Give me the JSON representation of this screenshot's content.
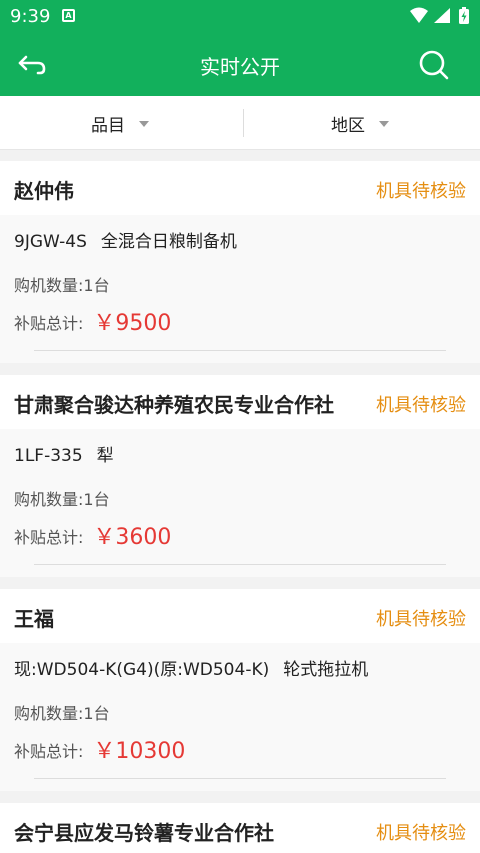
{
  "status_bar": {
    "time": "9:39",
    "app_icon_letter": "A"
  },
  "header": {
    "title": "实时公开"
  },
  "filters": [
    {
      "label": "品目"
    },
    {
      "label": "地区"
    }
  ],
  "labels": {
    "quantity": "购机数量:",
    "subsidy": "补贴总计:"
  },
  "records": [
    {
      "name": "赵仲伟",
      "status": "机具待核验",
      "model": "9JGW-4S",
      "product": "全混合日粮制备机",
      "quantity": "1台",
      "subsidy": "￥9500"
    },
    {
      "name": "甘肃聚合骏达种养殖农民专业合作社",
      "status": "机具待核验",
      "model": "1LF-335",
      "product": "犁",
      "quantity": "1台",
      "subsidy": "￥3600"
    },
    {
      "name": "王福",
      "status": "机具待核验",
      "model": "现:WD504-K(G4)(原:WD504-K)",
      "product": "轮式拖拉机",
      "quantity": "1台",
      "subsidy": "￥10300"
    },
    {
      "name": "会宁县应发马铃薯专业合作社",
      "status": "机具待核验",
      "model": "",
      "product": "",
      "quantity": "",
      "subsidy": ""
    }
  ]
}
